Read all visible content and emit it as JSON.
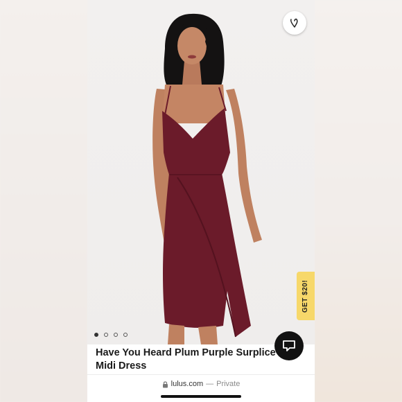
{
  "product": {
    "title_line1": "Have You Heard Plum Purple Surplice",
    "title_line2": "Midi Dress"
  },
  "gallery": {
    "total_images": 4,
    "active_index": 0
  },
  "promo": {
    "label": "GET $20!"
  },
  "browser": {
    "domain": "lulus.com",
    "separator": "—",
    "mode": "Private"
  },
  "icons": {
    "favorite": "heart-logo-icon",
    "chat": "chat-bubble-icon",
    "lock": "lock-icon"
  },
  "colors": {
    "dress": "#6b1b2a",
    "promo": "#f7d86a",
    "chat_button": "#121212"
  }
}
